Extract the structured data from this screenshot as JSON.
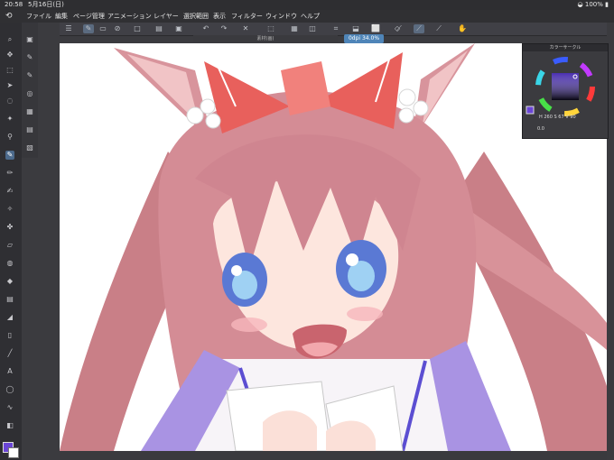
{
  "status": {
    "time": "20:58",
    "date": "5月16日(日)",
    "battery": "100%"
  },
  "menu": {
    "items": [
      "ファイル",
      "編集",
      "ページ管理",
      "アニメーション",
      "レイヤー",
      "選択範囲",
      "表示",
      "フィルター",
      "ウィンドウ",
      "ヘルプ"
    ]
  },
  "document": {
    "title": "素材(画)",
    "zoom": "0dpi 34.0%"
  },
  "color_panel": {
    "title": "カラーサークル",
    "h_label": "H",
    "h_value": "260",
    "s_label": "S",
    "s_value": "67",
    "v_label": "V",
    "v_value": "90",
    "bottom_left": "0.0",
    "main_color": "#6a45d6"
  },
  "icons": {
    "menu": "hamburger-icon",
    "undo": "undo-icon",
    "redo": "redo-icon"
  }
}
